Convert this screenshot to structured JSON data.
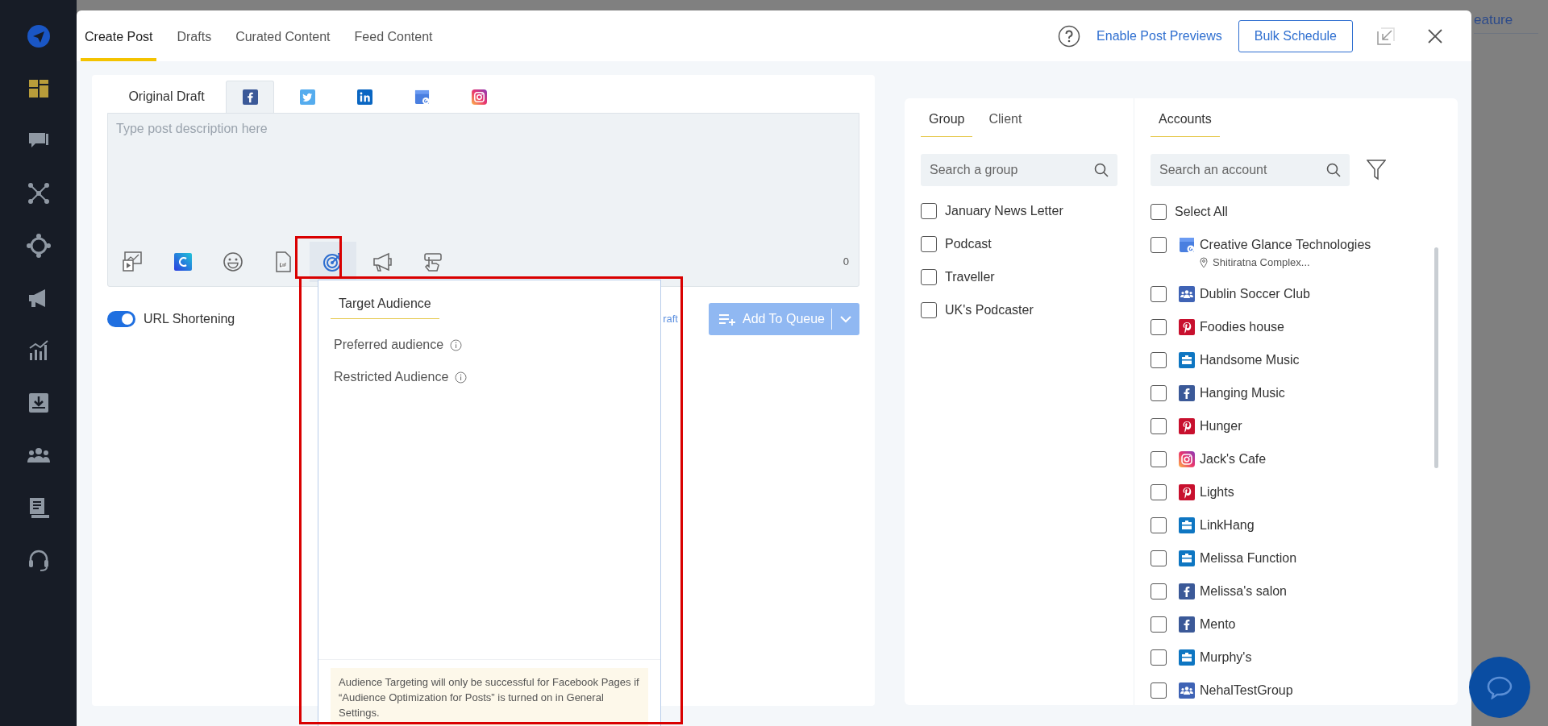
{
  "background": {
    "text": "eature"
  },
  "sidebar": {
    "items": [
      {
        "kind": "dashboard",
        "selected": true
      },
      {
        "kind": "chat",
        "selected": false
      },
      {
        "kind": "network",
        "selected": false
      },
      {
        "kind": "target",
        "selected": false
      },
      {
        "kind": "megaphone",
        "selected": false
      },
      {
        "kind": "chart",
        "selected": false
      },
      {
        "kind": "inbox",
        "selected": false
      },
      {
        "kind": "people",
        "selected": false
      },
      {
        "kind": "document",
        "selected": false
      },
      {
        "kind": "headset",
        "selected": false
      }
    ]
  },
  "tabs": [
    {
      "label": "Create Post",
      "selected": true
    },
    {
      "label": "Drafts",
      "selected": false
    },
    {
      "label": "Curated Content",
      "selected": false
    },
    {
      "label": "Feed Content",
      "selected": false
    }
  ],
  "header": {
    "link": "Enable Post Previews",
    "button": "Bulk Schedule"
  },
  "editor": {
    "platform_tabs": [
      {
        "kind": "text",
        "label": "Original Draft",
        "selected": false
      },
      {
        "kind": "facebook",
        "selected": true
      },
      {
        "kind": "twitter",
        "selected": false
      },
      {
        "kind": "linkedin",
        "selected": false
      },
      {
        "kind": "google",
        "selected": false
      },
      {
        "kind": "instagram",
        "selected": false
      }
    ],
    "placeholder": "Type post description here",
    "tools": [
      {
        "kind": "media",
        "selected": false
      },
      {
        "kind": "canva",
        "selected": false
      },
      {
        "kind": "emoji",
        "selected": false
      },
      {
        "kind": "gif",
        "selected": false
      },
      {
        "kind": "target",
        "selected": true
      },
      {
        "kind": "megaphone",
        "selected": false
      },
      {
        "kind": "hand",
        "selected": false
      }
    ],
    "count": "0"
  },
  "url_shortening": {
    "label": "URL Shortening",
    "on": true
  },
  "draft_link": "raft",
  "add_to_queue": {
    "label": "Add To Queue",
    "disabled": true
  },
  "audience_popup": {
    "tabs": [
      {
        "label": "Target Audience",
        "selected": true
      }
    ],
    "fields": [
      "Preferred audience",
      "Restricted Audience"
    ],
    "note": "Audience Targeting will only be successful for Facebook Pages if “Audience Optimization for Posts” is turned on in General Settings."
  },
  "groups": {
    "tabs": [
      {
        "label": "Group",
        "selected": true
      },
      {
        "label": "Client",
        "selected": false
      }
    ],
    "search_placeholder": "Search a group",
    "items": [
      {
        "label": "January News Letter",
        "checked": false
      },
      {
        "label": "Podcast",
        "checked": false
      },
      {
        "label": "Traveller",
        "checked": false
      },
      {
        "label": "UK's Podcaster",
        "checked": false
      }
    ]
  },
  "accounts": {
    "tabs": [
      {
        "label": "Accounts",
        "selected": true
      }
    ],
    "search_placeholder": "Search an account",
    "select_all": {
      "label": "Select All",
      "checked": false
    },
    "items": [
      {
        "name": "Creative Glance Technologies",
        "kind": "google",
        "checked": false,
        "location": "Shitiratna Complex..."
      },
      {
        "name": "Dublin Soccer Club",
        "kind": "group",
        "checked": false
      },
      {
        "name": "Foodies house",
        "kind": "pinterest",
        "checked": false
      },
      {
        "name": "Handsome Music",
        "kind": "page",
        "checked": false
      },
      {
        "name": "Hanging Music",
        "kind": "facebook",
        "checked": false
      },
      {
        "name": "Hunger",
        "kind": "pinterest",
        "checked": false
      },
      {
        "name": "Jack's Cafe",
        "kind": "instagram",
        "checked": false
      },
      {
        "name": "Lights",
        "kind": "pinterest",
        "checked": false
      },
      {
        "name": "LinkHang",
        "kind": "page",
        "checked": false
      },
      {
        "name": "Melissa Function",
        "kind": "page",
        "checked": false
      },
      {
        "name": "Melissa's salon",
        "kind": "facebook",
        "checked": false
      },
      {
        "name": "Mento",
        "kind": "facebook",
        "checked": false
      },
      {
        "name": "Murphy's",
        "kind": "page",
        "checked": false
      },
      {
        "name": "NehalTestGroup",
        "kind": "group",
        "checked": false
      }
    ]
  }
}
